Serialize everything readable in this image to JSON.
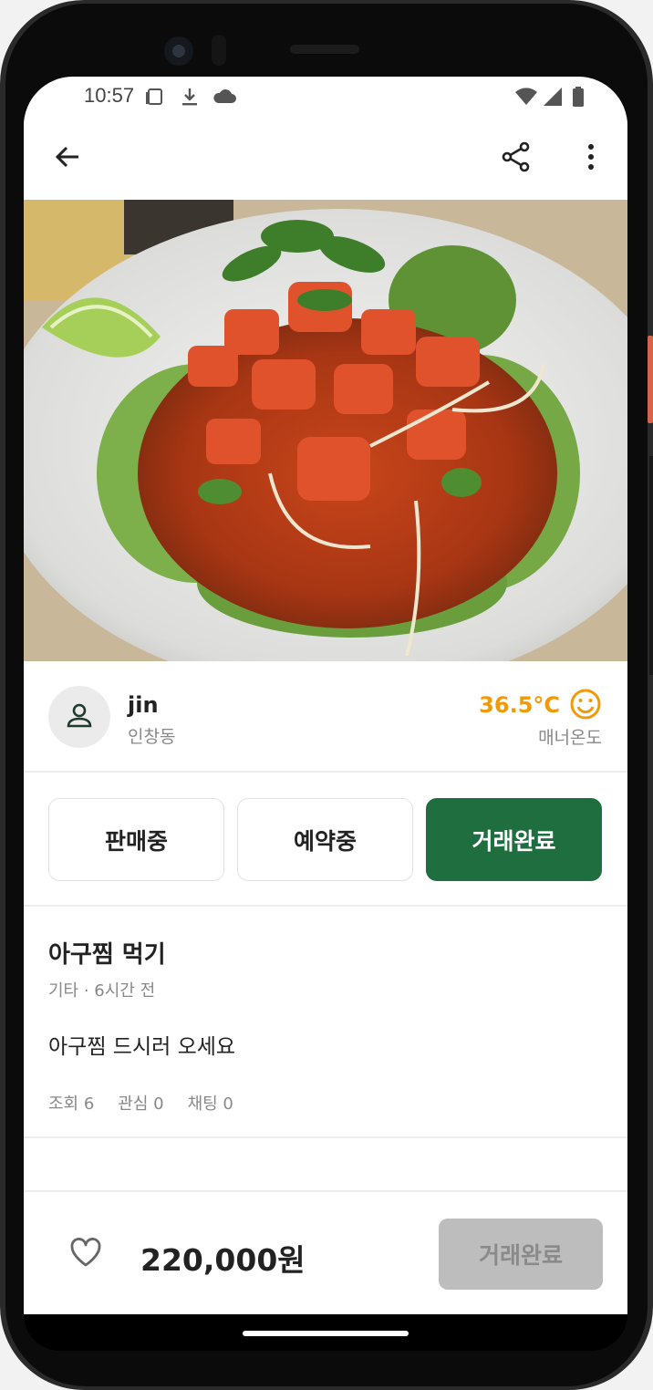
{
  "status_bar": {
    "time": "10:57",
    "left_icons": [
      "screenshot-icon",
      "download-icon",
      "cloud-icon"
    ],
    "right_icons": [
      "wifi-icon",
      "signal-icon",
      "battery-icon"
    ]
  },
  "app_bar": {
    "back_icon": "arrow-left-icon",
    "share_icon": "share-icon",
    "more_icon": "more-vertical-icon"
  },
  "seller": {
    "name": "jin",
    "location": "인창동",
    "temperature": "36.5°C",
    "manner_label": "매너온도",
    "temperature_color": "#f09a0a"
  },
  "status_buttons": [
    {
      "label": "판매중",
      "active": false
    },
    {
      "label": "예약중",
      "active": false
    },
    {
      "label": "거래완료",
      "active": true
    }
  ],
  "post": {
    "title": "아구찜 먹기",
    "meta": "기타 · 6시간 전",
    "content": "아구찜 드시러 오세요",
    "stats": [
      "조회 6",
      "관심 0",
      "채팅 0"
    ]
  },
  "bottom_bar": {
    "price": "220,000원",
    "deal_button": "거래완료"
  },
  "colors": {
    "accent": "#1e6e3f",
    "disabled": "#bdbdbd"
  }
}
